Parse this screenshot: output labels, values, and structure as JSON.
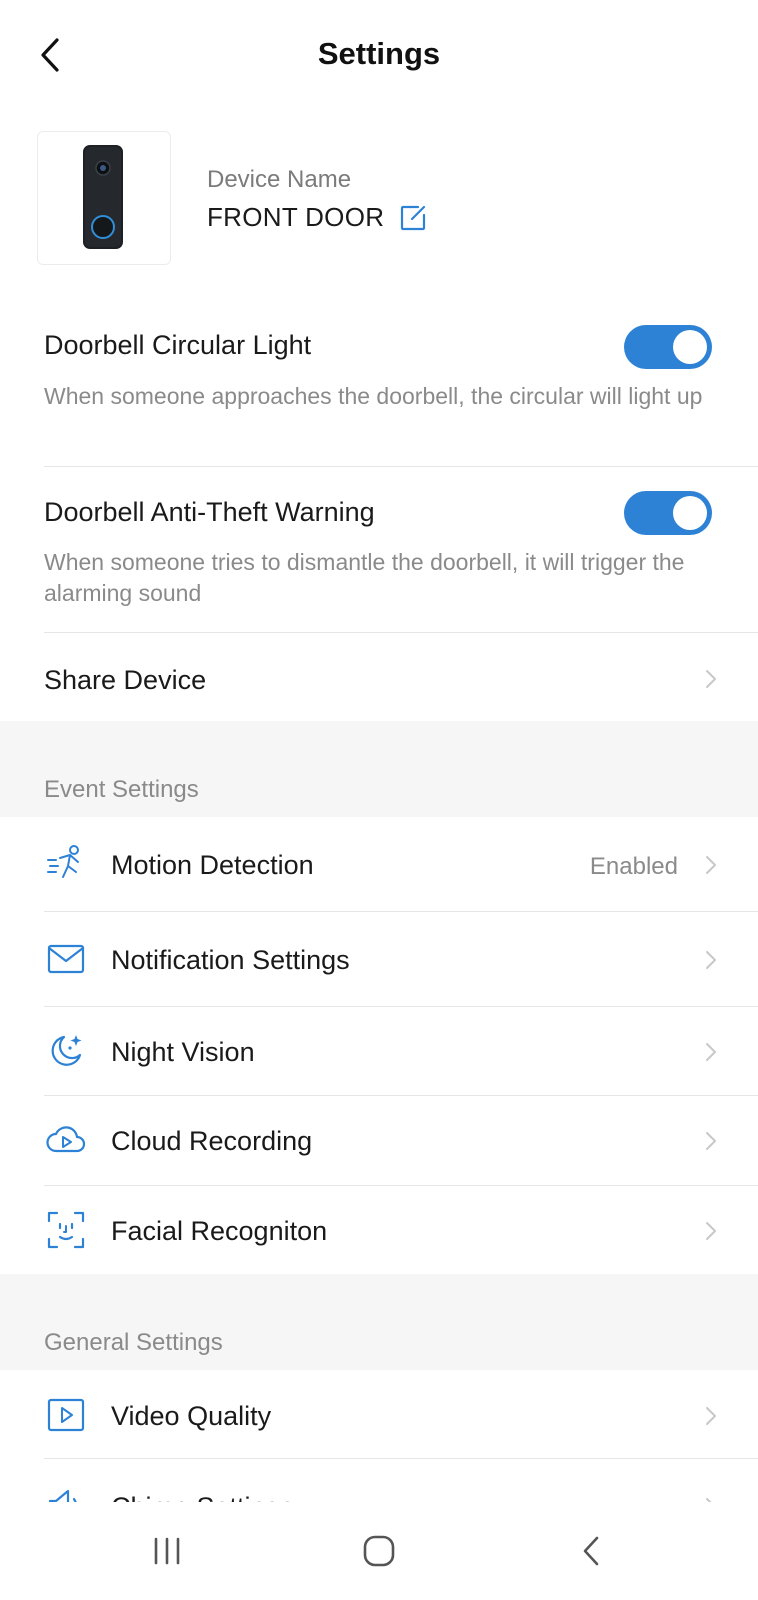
{
  "header": {
    "title": "Settings"
  },
  "device": {
    "name_label": "Device Name",
    "name": "FRONT DOOR"
  },
  "toggles": [
    {
      "title": "Doorbell Circular Light",
      "description": "When someone approaches the doorbell, the circular will light up",
      "enabled": true
    },
    {
      "title": "Doorbell Anti-Theft Warning",
      "description": "When someone tries to dismantle the doorbell, it will trigger the alarming sound",
      "enabled": true
    }
  ],
  "share": {
    "label": "Share Device"
  },
  "event_settings": {
    "section_label": "Event Settings",
    "items": [
      {
        "label": "Motion Detection",
        "value": "Enabled",
        "icon": "motion-detection-icon"
      },
      {
        "label": "Notification Settings",
        "icon": "envelope-icon"
      },
      {
        "label": "Night Vision",
        "icon": "moon-stars-icon"
      },
      {
        "label": "Cloud Recording",
        "icon": "cloud-play-icon"
      },
      {
        "label": "Facial Recogniton",
        "icon": "face-scan-icon"
      }
    ]
  },
  "general_settings": {
    "section_label": "General Settings",
    "items": [
      {
        "label": "Video Quality",
        "icon": "video-play-icon"
      },
      {
        "label": "Chime Settings",
        "icon": "speaker-icon"
      }
    ]
  },
  "colors": {
    "accent": "#2d82d6",
    "toggle_on": "#2d82d6",
    "section_background": "#f6f6f6",
    "secondary_text": "#8a8a8a"
  }
}
